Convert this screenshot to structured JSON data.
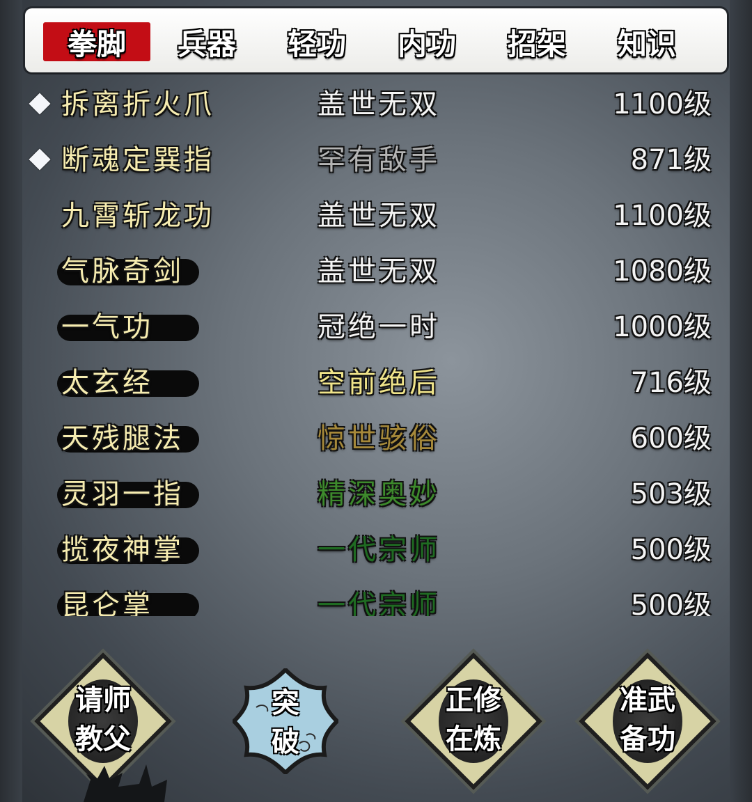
{
  "tabs": [
    {
      "label": "拳脚",
      "active": true
    },
    {
      "label": "兵器",
      "active": false
    },
    {
      "label": "轻功",
      "active": false
    },
    {
      "label": "内功",
      "active": false
    },
    {
      "label": "招架",
      "active": false
    },
    {
      "label": "知识",
      "active": false
    }
  ],
  "skills": [
    {
      "name": "拆离折火爪",
      "rank": "盖世无双",
      "level": "1100级",
      "rank_color": "#f4f4f4",
      "equipped": true,
      "name_bg": false
    },
    {
      "name": "断魂定巽指",
      "rank": "罕有敌手",
      "level": "871级",
      "rank_color": "#b4b4b4",
      "equipped": true,
      "name_bg": false
    },
    {
      "name": "九霄斩龙功",
      "rank": "盖世无双",
      "level": "1100级",
      "rank_color": "#f4f4f4",
      "equipped": false,
      "name_bg": false
    },
    {
      "name": "气脉奇剑",
      "rank": "盖世无双",
      "level": "1080级",
      "rank_color": "#f4f4f4",
      "equipped": false,
      "name_bg": true
    },
    {
      "name": "一气功",
      "rank": "冠绝一时",
      "level": "1000级",
      "rank_color": "#f4f4f4",
      "equipped": false,
      "name_bg": true
    },
    {
      "name": "太玄经",
      "rank": "空前绝后",
      "level": "716级",
      "rank_color": "#f0e48a",
      "equipped": false,
      "name_bg": true
    },
    {
      "name": "天残腿法",
      "rank": "惊世骇俗",
      "level": "600级",
      "rank_color": "#a6893a",
      "equipped": false,
      "name_bg": true
    },
    {
      "name": "灵羽一指",
      "rank": "精深奥妙",
      "level": "503级",
      "rank_color": "#3d8a2c",
      "equipped": false,
      "name_bg": true
    },
    {
      "name": "揽夜神掌",
      "rank": "一代宗师",
      "level": "500级",
      "rank_color": "#1f6b22",
      "equipped": false,
      "name_bg": true
    },
    {
      "name": "昆仑掌",
      "rank": "一代宗师",
      "level": "500级",
      "rank_color": "#1f6b22",
      "equipped": false,
      "name_bg": true
    }
  ],
  "buttons": [
    {
      "line1": "请师",
      "line2": "教父"
    },
    {
      "line1": "突",
      "line2": "破"
    },
    {
      "line1": "正修",
      "line2": "在炼"
    },
    {
      "line1": "准武",
      "line2": "备功"
    }
  ],
  "colors": {
    "active_tab": "#c30d15",
    "skill_name": "#f6ecb0",
    "button_face": "#d7d3a5",
    "break_button_face": "#a9cfe0"
  }
}
